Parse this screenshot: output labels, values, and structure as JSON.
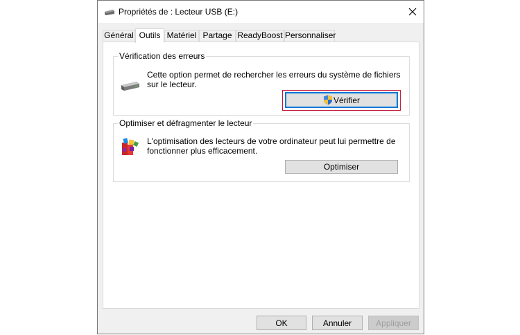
{
  "window": {
    "title": "Propriétés de : Lecteur USB (E:)",
    "title_icon": "usb-drive-icon",
    "close_icon": "close-icon"
  },
  "tabs": [
    {
      "label": "Général",
      "active": false
    },
    {
      "label": "Outils",
      "active": true
    },
    {
      "label": "Matériel",
      "active": false
    },
    {
      "label": "Partage",
      "active": false
    },
    {
      "label": "ReadyBoost",
      "active": false
    },
    {
      "label": "Personnaliser",
      "active": false
    }
  ],
  "error_check": {
    "title": "Vérification des erreurs",
    "description": "Cette option permet de rechercher les erreurs du système de fichiers sur le lecteur.",
    "button_label": "Vérifier",
    "icon": "drive-icon",
    "button_icon": "uac-shield-icon"
  },
  "optimize": {
    "title": "Optimiser et défragmenter le lecteur",
    "description": "L'optimisation des lecteurs de votre ordinateur peut lui permettre de fonctionner plus efficacement.",
    "button_label": "Optimiser",
    "icon": "defrag-icon"
  },
  "footer": {
    "ok_label": "OK",
    "cancel_label": "Annuler",
    "apply_label": "Appliquer"
  },
  "colors": {
    "focus_border": "#0078d7",
    "focus_ring": "#c2183a"
  }
}
